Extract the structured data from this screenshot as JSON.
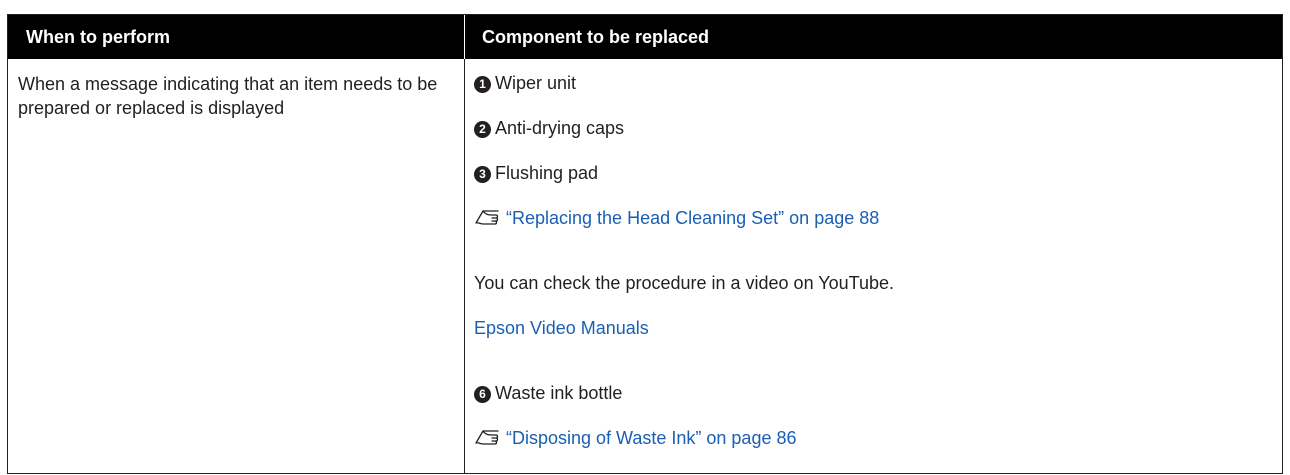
{
  "table": {
    "header": {
      "col1": "When to perform",
      "col2": "Component to be replaced"
    },
    "row": {
      "when": "When a message indicating that an item needs to be prepared or replaced is displayed",
      "items": [
        {
          "num": "1",
          "label": "Wiper unit"
        },
        {
          "num": "2",
          "label": "Anti-drying caps"
        },
        {
          "num": "3",
          "label": "Flushing pad"
        }
      ],
      "ref1": "“Replacing the Head Cleaning Set” on page 88",
      "video_text": "You can check the procedure in a video on YouTube.",
      "video_link": "Epson Video Manuals",
      "item4": {
        "num": "6",
        "label": "Waste ink bottle"
      },
      "ref2": "“Disposing of Waste Ink” on page 86"
    }
  },
  "icons": {
    "reference": "pointing-hand-reference-icon"
  },
  "colors": {
    "header_bg": "#000000",
    "header_text": "#ffffff",
    "link": "#1a5fb4",
    "text": "#231f20"
  }
}
